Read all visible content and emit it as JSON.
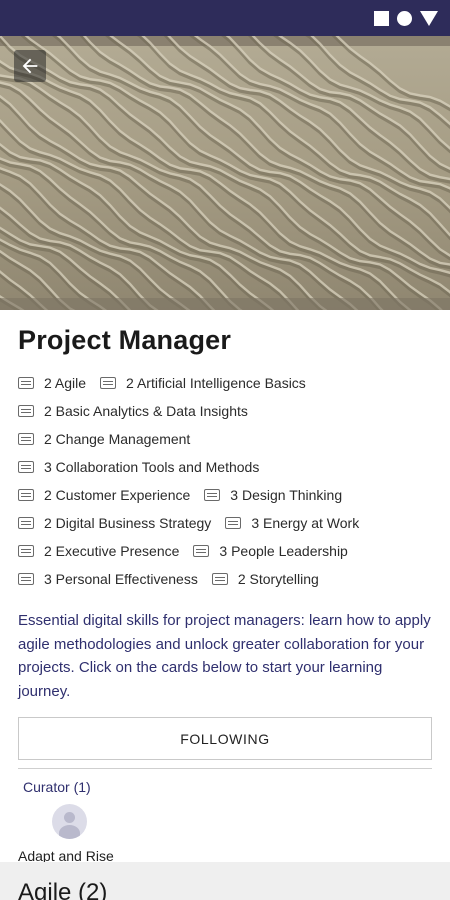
{
  "status_bar": {
    "icons": [
      "square-icon",
      "circle-icon",
      "triangle-icon"
    ]
  },
  "hero": {
    "back_icon": "arrow-left-icon"
  },
  "page": {
    "title": "Project Manager",
    "tag_rows": [
      [
        {
          "label": "2 Agile"
        },
        {
          "label": "2 Artificial Intelligence Basics"
        }
      ],
      [
        {
          "label": "2 Basic Analytics & Data Insights"
        }
      ],
      [
        {
          "label": "2 Change Management"
        }
      ],
      [
        {
          "label": "3 Collaboration Tools and Methods"
        }
      ],
      [
        {
          "label": "2 Customer Experience"
        },
        {
          "label": "3 Design Thinking"
        }
      ],
      [
        {
          "label": "2 Digital Business Strategy"
        },
        {
          "label": "3 Energy at Work"
        }
      ],
      [
        {
          "label": "2 Executive Presence"
        },
        {
          "label": "3 People Leadership"
        }
      ],
      [
        {
          "label": "3 Personal Effectiveness"
        },
        {
          "label": "2 Storytelling"
        }
      ]
    ],
    "description": "Essential digital skills for project managers: learn how to apply agile methodologies and unlock greater collaboration for your projects. Click on the cards below to start your learning journey.",
    "follow_label": "FOLLOWING",
    "curator_label": "Curator (1)",
    "curator_name": "Adapt and Rise"
  },
  "section": {
    "title": "Agile (2)"
  },
  "colors": {
    "status_bar": "#2e2c5a",
    "accent_text": "#2f2f6e",
    "sand": "#a79e86"
  }
}
